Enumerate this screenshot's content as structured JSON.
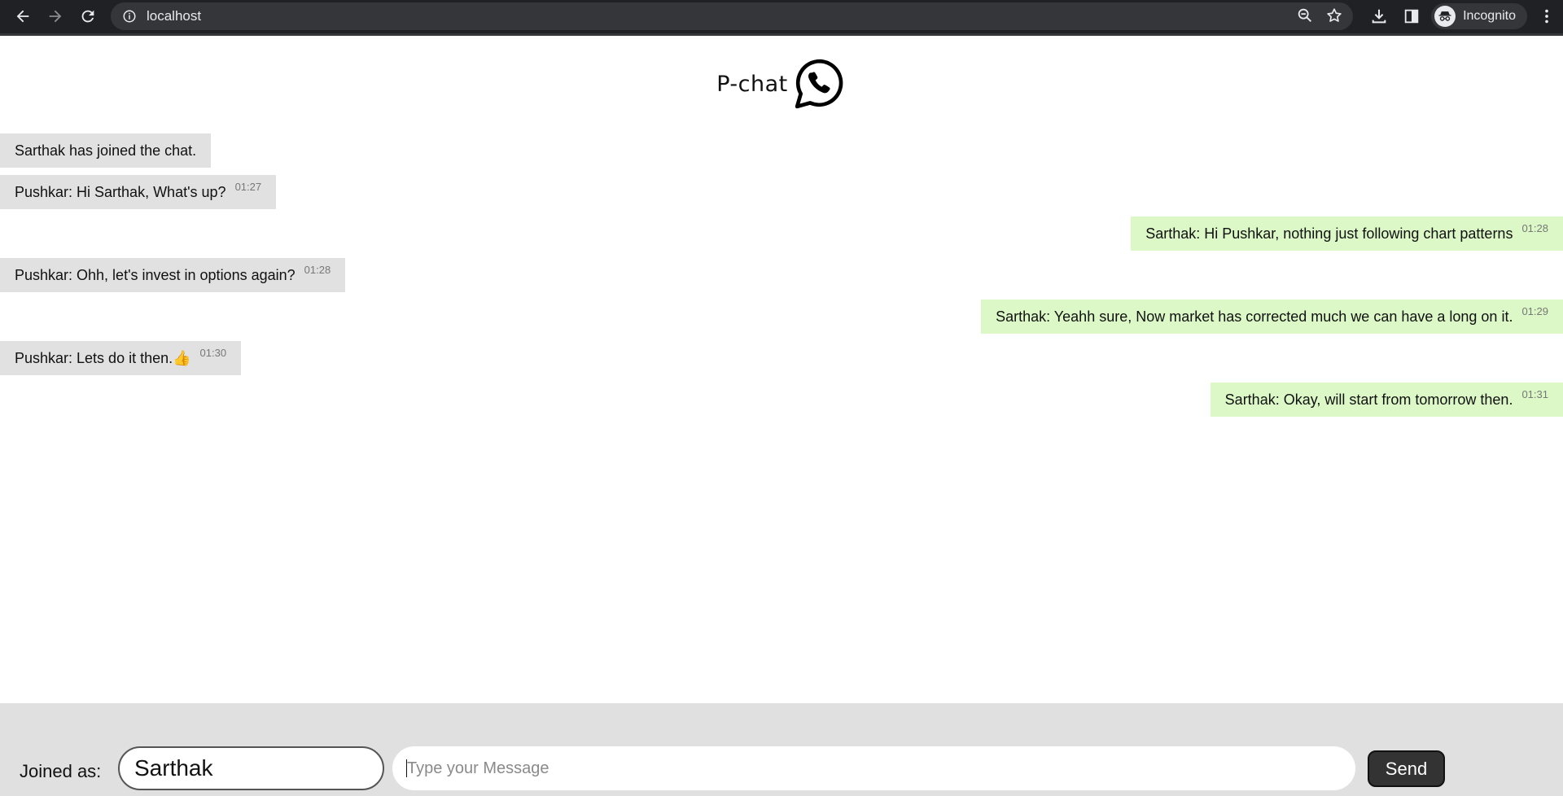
{
  "browser": {
    "url": "localhost",
    "profile_label": "Incognito"
  },
  "app": {
    "title": "P-chat",
    "logo_icon": "whatsapp-icon"
  },
  "messages": [
    {
      "text": "Sarthak has joined the chat.",
      "time": "",
      "side": "left"
    },
    {
      "text": "Pushkar: Hi Sarthak, What's up?",
      "time": "01:27",
      "side": "left"
    },
    {
      "text": "Sarthak: Hi Pushkar, nothing just following chart patterns",
      "time": "01:28",
      "side": "right"
    },
    {
      "text": "Pushkar: Ohh, let's invest in options again?",
      "time": "01:28",
      "side": "left"
    },
    {
      "text": "Sarthak: Yeahh sure, Now market has corrected much we can have a long on it.",
      "time": "01:29",
      "side": "right"
    },
    {
      "text": "Pushkar: Lets do it then.",
      "emoji": "👍",
      "time": "01:30",
      "side": "left"
    },
    {
      "text": "Sarthak: Okay, will start from tomorrow then.",
      "time": "01:31",
      "side": "right"
    }
  ],
  "composer": {
    "joined_label": "Joined as:",
    "username": "Sarthak",
    "message_placeholder": "Type your Message",
    "message_value": "",
    "send_label": "Send"
  },
  "colors": {
    "incoming_bubble": "#e1e1e1",
    "outgoing_bubble": "#dcf8c6",
    "composer_bg": "#e0e0e0",
    "send_button": "#333333"
  }
}
